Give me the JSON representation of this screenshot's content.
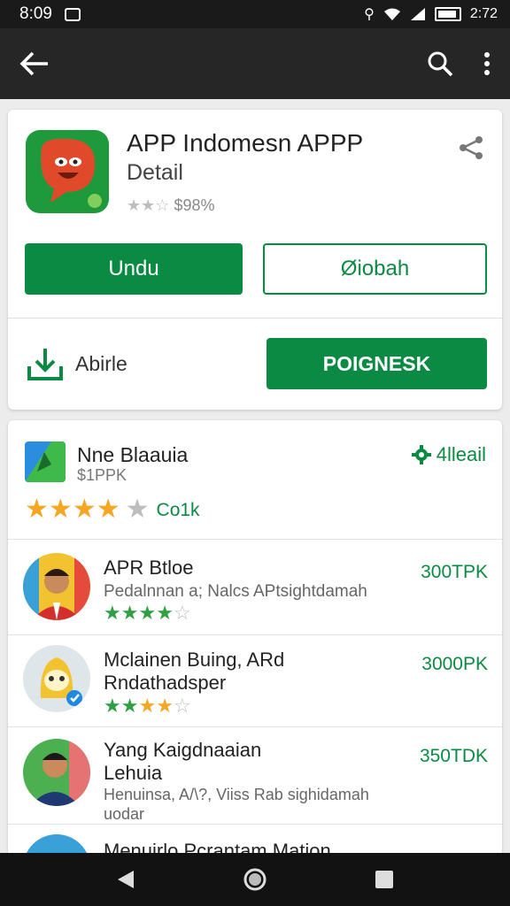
{
  "status_bar": {
    "time": "8:09",
    "right_text": "ᛒ ▾",
    "battery_text": "2:72"
  },
  "app_bar": {
    "back_icon": "arrow-left-icon",
    "search_icon": "search-icon",
    "more_icon": "more-vertical-icon"
  },
  "app_card": {
    "title": "APP Indomesn APPP",
    "subtitle": "Detail",
    "rating_text": "$98%",
    "install_label": "Undu",
    "secondary_label": "Øiobah",
    "download_label": "Abirle",
    "primary_label": "POIGNESK",
    "colors": {
      "green": "#0b8a43",
      "icon_red": "#e04a2a"
    }
  },
  "featured": {
    "title": "Nne Blaauia",
    "subtitle": "$1PPK",
    "badge": "4lleail",
    "stars_filled": 4,
    "stars_total": 5,
    "count": "Co1k"
  },
  "list": [
    {
      "title": "APR Btloe",
      "description": "Pedalnnan a; Nalcs APtsightdamah",
      "price": "300TPK",
      "rating": 3.5
    },
    {
      "title": "Mclainen Buing, ARd\nRndathadsper",
      "description": "",
      "price": "3000PK",
      "rating": 3.5
    },
    {
      "title": "Yang Kaigdnaaian\nLehuia",
      "description": "Henuinsa, A/\\?, Viiss Rab sighidamah\nuodar",
      "price": "350TDK",
      "rating": 0
    },
    {
      "title": "Menuirlo Pcrantam Mation",
      "description": "",
      "price": "",
      "rating": 0
    }
  ],
  "nav_bar": {
    "back_icon": "nav-back-icon",
    "home_icon": "nav-home-icon",
    "recents_icon": "nav-recents-icon"
  }
}
